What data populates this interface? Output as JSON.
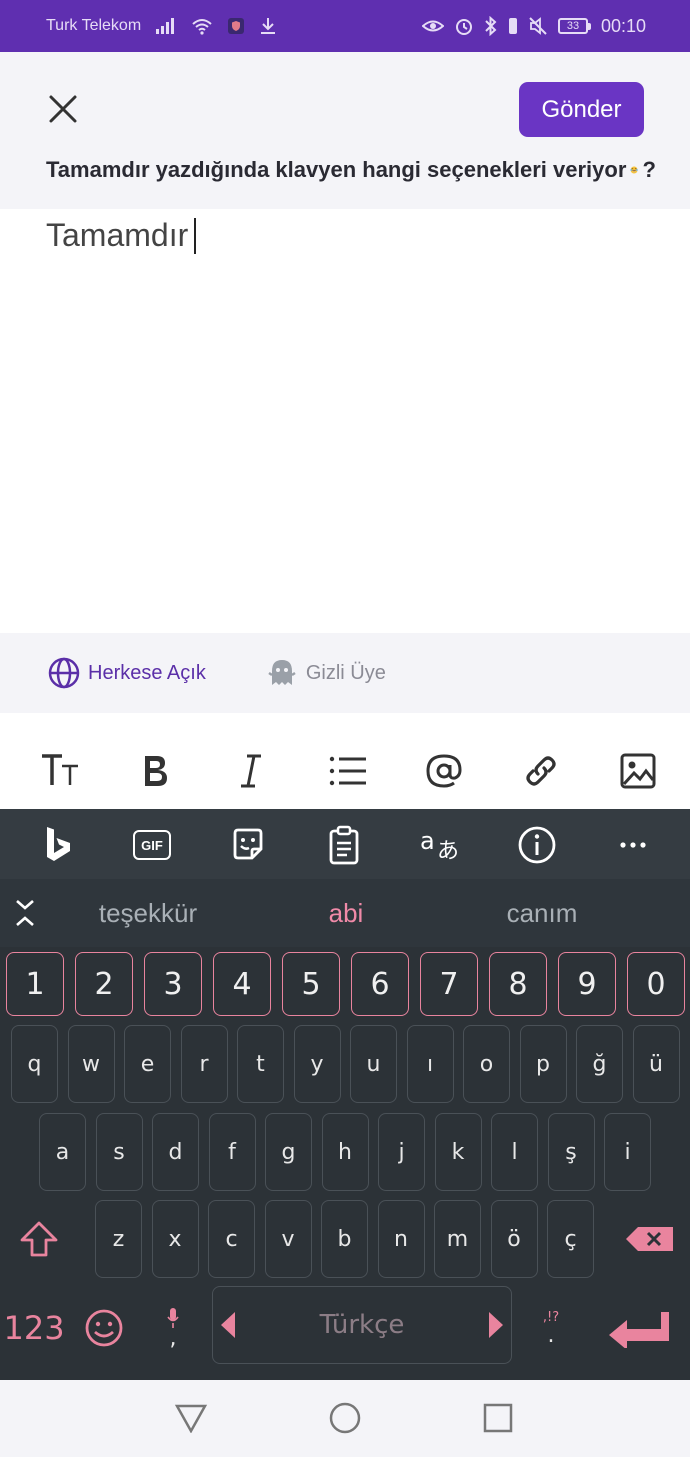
{
  "status_bar": {
    "carrier": "Turk Telekom",
    "battery": "33",
    "time": "00:10"
  },
  "header": {
    "send_label": "Gönder",
    "question": "Tamamdır yazdığında klavyen hangi seçenekleri veriyor",
    "question_end": "?"
  },
  "compose": {
    "text": "Tamamdır"
  },
  "visibility": {
    "public_label": "Herkese Açık",
    "anon_label": "Gizli Üye"
  },
  "keyboard": {
    "suggestions": [
      "teşekkür",
      "abi",
      "canım"
    ],
    "gif_label": "GIF",
    "number_row": [
      "1",
      "2",
      "3",
      "4",
      "5",
      "6",
      "7",
      "8",
      "9",
      "0"
    ],
    "row1": [
      "q",
      "w",
      "e",
      "r",
      "t",
      "y",
      "u",
      "ı",
      "o",
      "p",
      "ğ",
      "ü"
    ],
    "row2": [
      "a",
      "s",
      "d",
      "f",
      "g",
      "h",
      "j",
      "k",
      "l",
      "ş",
      "i"
    ],
    "row3": [
      "z",
      "x",
      "c",
      "v",
      "b",
      "n",
      "m",
      "ö",
      "ç"
    ],
    "symbols_label": "123",
    "comma": ",",
    "period": ".",
    "punct_hint": ",!?",
    "space_label": "Türkçe"
  },
  "colors": {
    "brand": "#6a35c4",
    "status_bar": "#5f2fb0",
    "keyboard_bg": "#2c3237",
    "keyboard_accent": "#e9849e"
  }
}
